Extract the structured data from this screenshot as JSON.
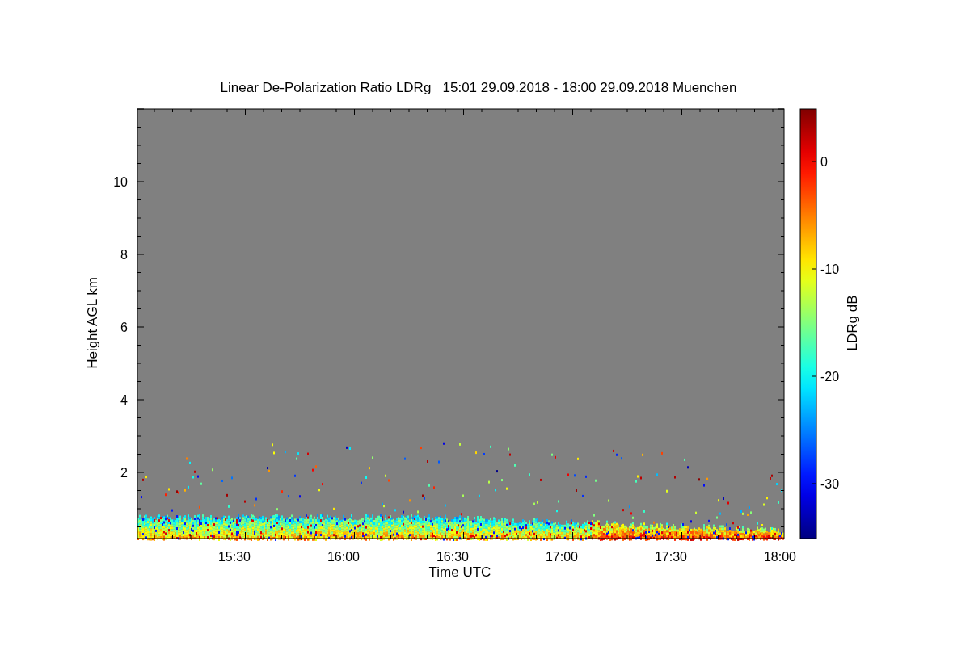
{
  "title": "Linear De-Polarization Ratio LDRg   15:01 29.09.2018 - 18:00 29.09.2018 Muenchen",
  "y_axis": {
    "label": "Height AGL km",
    "ticks": [
      "10",
      "8",
      "6",
      "4",
      "2"
    ]
  },
  "x_axis": {
    "label": "Time UTC",
    "ticks": [
      "15:30",
      "16:00",
      "16:30",
      "17:00",
      "17:30",
      "18:00"
    ]
  },
  "colorbar": {
    "label": "LDRg dB",
    "ticks": [
      "0",
      "-10",
      "-20",
      "-30"
    ]
  }
}
